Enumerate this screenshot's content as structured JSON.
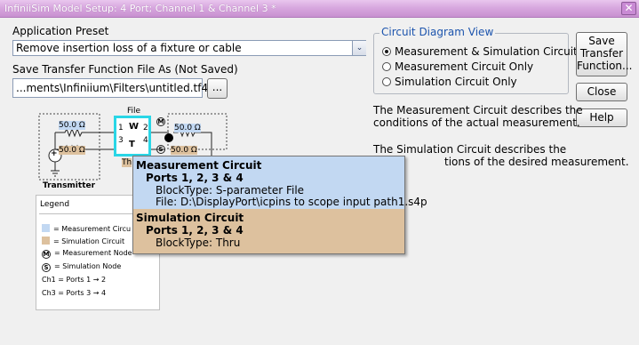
{
  "window": {
    "title": "InfiniiSim Model Setup: 4 Port; Channel 1 & Channel 3 *",
    "close_glyph": "✕"
  },
  "preset": {
    "label": "Application Preset",
    "value": "Remove insertion loss of a fixture or cable",
    "dropdown_glyph": "⌄"
  },
  "save_file": {
    "label": "Save Transfer Function File As (Not Saved)",
    "value": "...ments\\Infiniium\\Filters\\untitled.tf4",
    "browse_label": "..."
  },
  "circuit_view": {
    "label": "Circuit Diagram View",
    "options": [
      {
        "label": "Measurement & Simulation Circuits",
        "selected": true
      },
      {
        "label": "Measurement Circuit Only",
        "selected": false
      },
      {
        "label": "Simulation Circuit Only",
        "selected": false
      }
    ]
  },
  "buttons": {
    "save_transfer_line1": "Save",
    "save_transfer_line2": "Transfer",
    "save_transfer_line3": "Function...",
    "close": "Close",
    "help": "Help"
  },
  "description": {
    "measurement_line1": "The Measurement Circuit describes the",
    "measurement_line2": "conditions of the actual measurement.",
    "simulation_line1": "The Simulation Circuit describes the",
    "simulation_line2": "tions of the desired measurement."
  },
  "diagram": {
    "file_label": "File",
    "block_w": "W",
    "block_t": "T",
    "port1": "1",
    "port2": "2",
    "port3": "3",
    "port4": "4",
    "res1": "50.0 Ω",
    "res2": "50.0 Ω",
    "res3": "50.0 Ω",
    "res4": "50.0 Ω",
    "node_m": "M",
    "node_s": "S",
    "thru_label": "Th",
    "transmitter_label": "Transmitter",
    "source_plus": "+"
  },
  "legend": {
    "title": "Legend",
    "measurement_circuit": "= Measurement Circu",
    "simulation_circuit": "= Simulation Circuit",
    "measurement_node": "= Measurement Node",
    "simulation_node": "= Simulation Node",
    "ch1": "Ch1 = Ports 1 → 2",
    "ch3": "Ch3 = Ports 3 → 4",
    "node_m": "M",
    "node_s": "S",
    "colors": {
      "measurement": "#c2d8f2",
      "simulation": "#ddc19e"
    }
  },
  "tooltip": {
    "meas_title": "Measurement Circuit",
    "meas_ports": "Ports 1, 2, 3 & 4",
    "meas_blocktype": "BlockType: S-parameter File",
    "meas_file": "File: D:\\DisplayPort\\icpins to scope input path1.s4p",
    "sim_title": "Simulation Circuit",
    "sim_ports": "Ports 1, 2, 3 & 4",
    "sim_blocktype": "BlockType: Thru"
  }
}
